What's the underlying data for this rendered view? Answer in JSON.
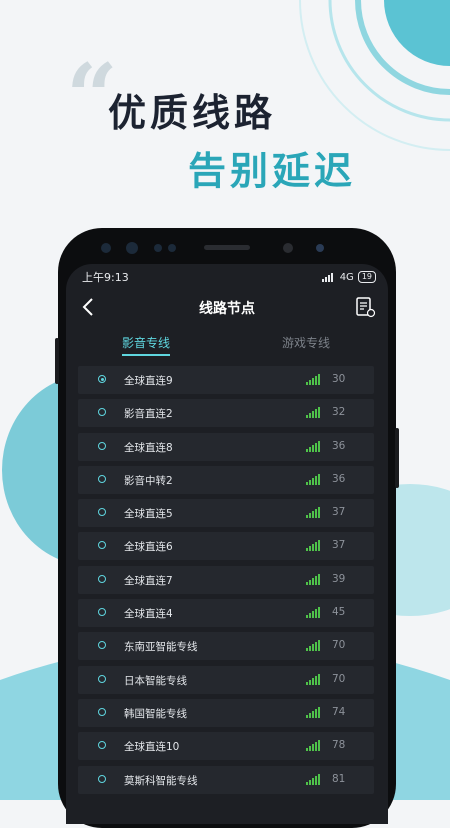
{
  "hero": {
    "quote_mark": "“",
    "line1": "优质线路",
    "line2": "告别延迟"
  },
  "colors": {
    "accent": "#2aa6b8",
    "tab_active": "#5fd6df",
    "signal": "#4fc34a",
    "background": "#f3f5f7"
  },
  "status_bar": {
    "time": "上午9:13",
    "network": "4G",
    "battery": "19"
  },
  "header": {
    "title": "线路节点",
    "back_icon": "chevron-left-icon",
    "right_icon": "document-help-icon"
  },
  "tabs": [
    {
      "label": "影音专线",
      "active": true
    },
    {
      "label": "游戏专线",
      "active": false
    }
  ],
  "nodes": [
    {
      "name": "全球直连9",
      "ping": "30",
      "selected": true
    },
    {
      "name": "影音直连2",
      "ping": "32",
      "selected": false
    },
    {
      "name": "全球直连8",
      "ping": "36",
      "selected": false
    },
    {
      "name": "影音中转2",
      "ping": "36",
      "selected": false
    },
    {
      "name": "全球直连5",
      "ping": "37",
      "selected": false
    },
    {
      "name": "全球直连6",
      "ping": "37",
      "selected": false
    },
    {
      "name": "全球直连7",
      "ping": "39",
      "selected": false
    },
    {
      "name": "全球直连4",
      "ping": "45",
      "selected": false
    },
    {
      "name": "东南亚智能专线",
      "ping": "70",
      "selected": false
    },
    {
      "name": "日本智能专线",
      "ping": "70",
      "selected": false
    },
    {
      "name": "韩国智能专线",
      "ping": "74",
      "selected": false
    },
    {
      "name": "全球直连10",
      "ping": "78",
      "selected": false
    },
    {
      "name": "莫斯科智能专线",
      "ping": "81",
      "selected": false
    }
  ]
}
